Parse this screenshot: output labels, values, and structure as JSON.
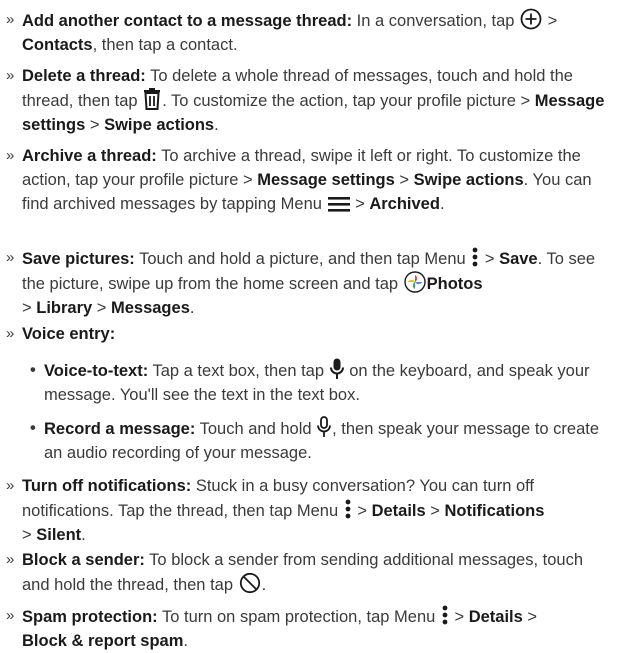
{
  "bullet": "»",
  "subbullet": "•",
  "items": [
    {
      "t": "Add another contact to a message thread:",
      "a": " In a conversation, tap ",
      "b": " > ",
      "c": "Contacts",
      "d": ", then tap a contact."
    },
    {
      "t": "Delete a thread:",
      "a": " To delete a whole thread of messages, touch and hold the thread, then tap ",
      "b": ". To customize the action, tap your profile picture > ",
      "c": "Message settings",
      "d": " > ",
      "e": "Swipe actions",
      "f": "."
    },
    {
      "t": "Archive a thread:",
      "a": " To archive a thread, swipe it left or right. To customize the action, tap your profile picture > ",
      "b": "Message settings",
      "c": " > ",
      "d": "Swipe actions",
      "e": ". You can find archived messages by tapping Menu ",
      "f": " > ",
      "g": "Archived",
      "h": "."
    },
    {
      "t": "Save pictures:",
      "a": " Touch and hold a picture, and then tap Menu ",
      "b": " > ",
      "c": "Save",
      "d": ". To see the picture, swipe up from the home screen and tap ",
      "e": "Photos",
      "f": " > ",
      "g": "Library",
      "h": " > ",
      "i": "Messages",
      "j": "."
    },
    {
      "t": "Voice entry:"
    },
    {
      "t": "Voice-to-text:",
      "a": " Tap a text box, then tap ",
      "b": " on the keyboard, and speak your message. You'll see the text in the text box."
    },
    {
      "t": "Record a message:",
      "a": " Touch and hold ",
      "b": ", then speak your message to create an audio recording of your message."
    },
    {
      "t": "Turn off notifications:",
      "a": " Stuck in a busy conversation? You can turn off notifications. Tap the thread, then tap Menu ",
      "b": " > ",
      "c": "Details",
      "d": " > ",
      "e": "Notifications",
      "f": " > ",
      "g": "Silent",
      "h": "."
    },
    {
      "t": "Block a sender:",
      "a": " To block a sender from sending additional messages, touch and hold the thread, then tap ",
      "b": "."
    },
    {
      "t": "Spam protection:",
      "a": " To turn on spam protection, tap Menu ",
      "b": " > ",
      "c": "Details",
      "d": " > ",
      "e": "Block & report spam",
      "f": "."
    }
  ],
  "icons": {
    "add": "add-circle-icon",
    "delete": "trash-icon",
    "menu": "hamburger-menu-icon",
    "more": "more-vertical-icon",
    "photos": "google-photos-icon",
    "mic": "microphone-icon",
    "mic_outline": "microphone-outline-icon",
    "block": "block-icon"
  },
  "colors": {
    "text": "#3a3a3a",
    "bold": "#1a1a1a"
  }
}
